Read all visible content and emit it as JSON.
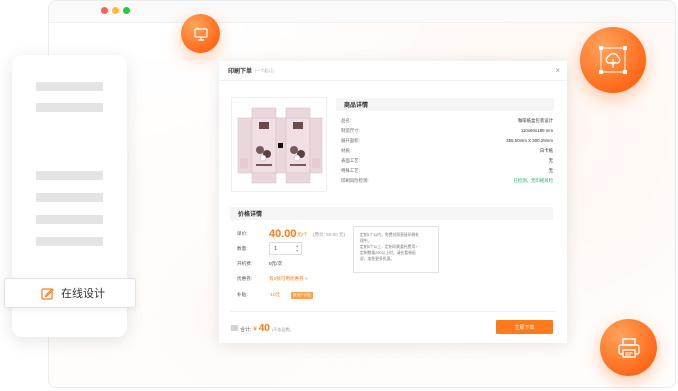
{
  "left_panel": {
    "design_button_label": "在线设计"
  },
  "modal": {
    "title": "印刷下单",
    "subtitle": "(一个起订)",
    "close_label": "×",
    "product_section_title": "商品详情",
    "product_details": [
      {
        "label": "品名:",
        "value": "咖啡纸盒包装设计"
      },
      {
        "label": "制造尺寸:",
        "value": "110x60x180 mm"
      },
      {
        "label": "展开面积:",
        "value": "355.50mm X 300.25mm"
      },
      {
        "label": "材质:",
        "value": "白卡纸"
      },
      {
        "label": "表面工艺:",
        "value": "无"
      },
      {
        "label": "特殊工艺:",
        "value": "无"
      },
      {
        "label": "印刷风险检测:",
        "value": "已检测，无印刷风险"
      }
    ],
    "price_section_title": "价格详情",
    "unit_price_label": "单价:",
    "unit_price": "40.00",
    "unit_suffix": "元/个",
    "original_price_text": "(原价: 50.00 元)",
    "quantity_label": "数量:",
    "quantity_value": "1",
    "plate_fee_label": "开机费:",
    "plate_fee_value": "0元/次",
    "coupon_label": "优惠券:",
    "coupon_value": "有2张可用优惠券 >",
    "subsidy_label": "补贴:",
    "subsidy_value": "-10元",
    "subsidy_tag": "新用户补贴",
    "tip_lines": [
      "定制1个以内，免费对照直接印刷处",
      "理中。",
      "定制5个以上，定制印刷委托费用+",
      "定制数量200以上时，请在看装画",
      "说，加急更多优惠。"
    ],
    "total_label": "合计:",
    "total_currency": "¥",
    "total_value": "40",
    "total_note": "(不含运费)",
    "order_button_label": "立即下单"
  },
  "colors": {
    "accent": "#ff7a1a",
    "success": "#27ae60",
    "traffic_red": "#ff5f56",
    "traffic_yellow": "#ffbd2e",
    "traffic_green": "#27c93f"
  },
  "icons": {
    "top_circle": "design-card-icon",
    "right_circle": "cloud-tree-icon",
    "bottom_circle": "printer-icon",
    "design_button": "edit-icon",
    "total": "list-icon"
  }
}
